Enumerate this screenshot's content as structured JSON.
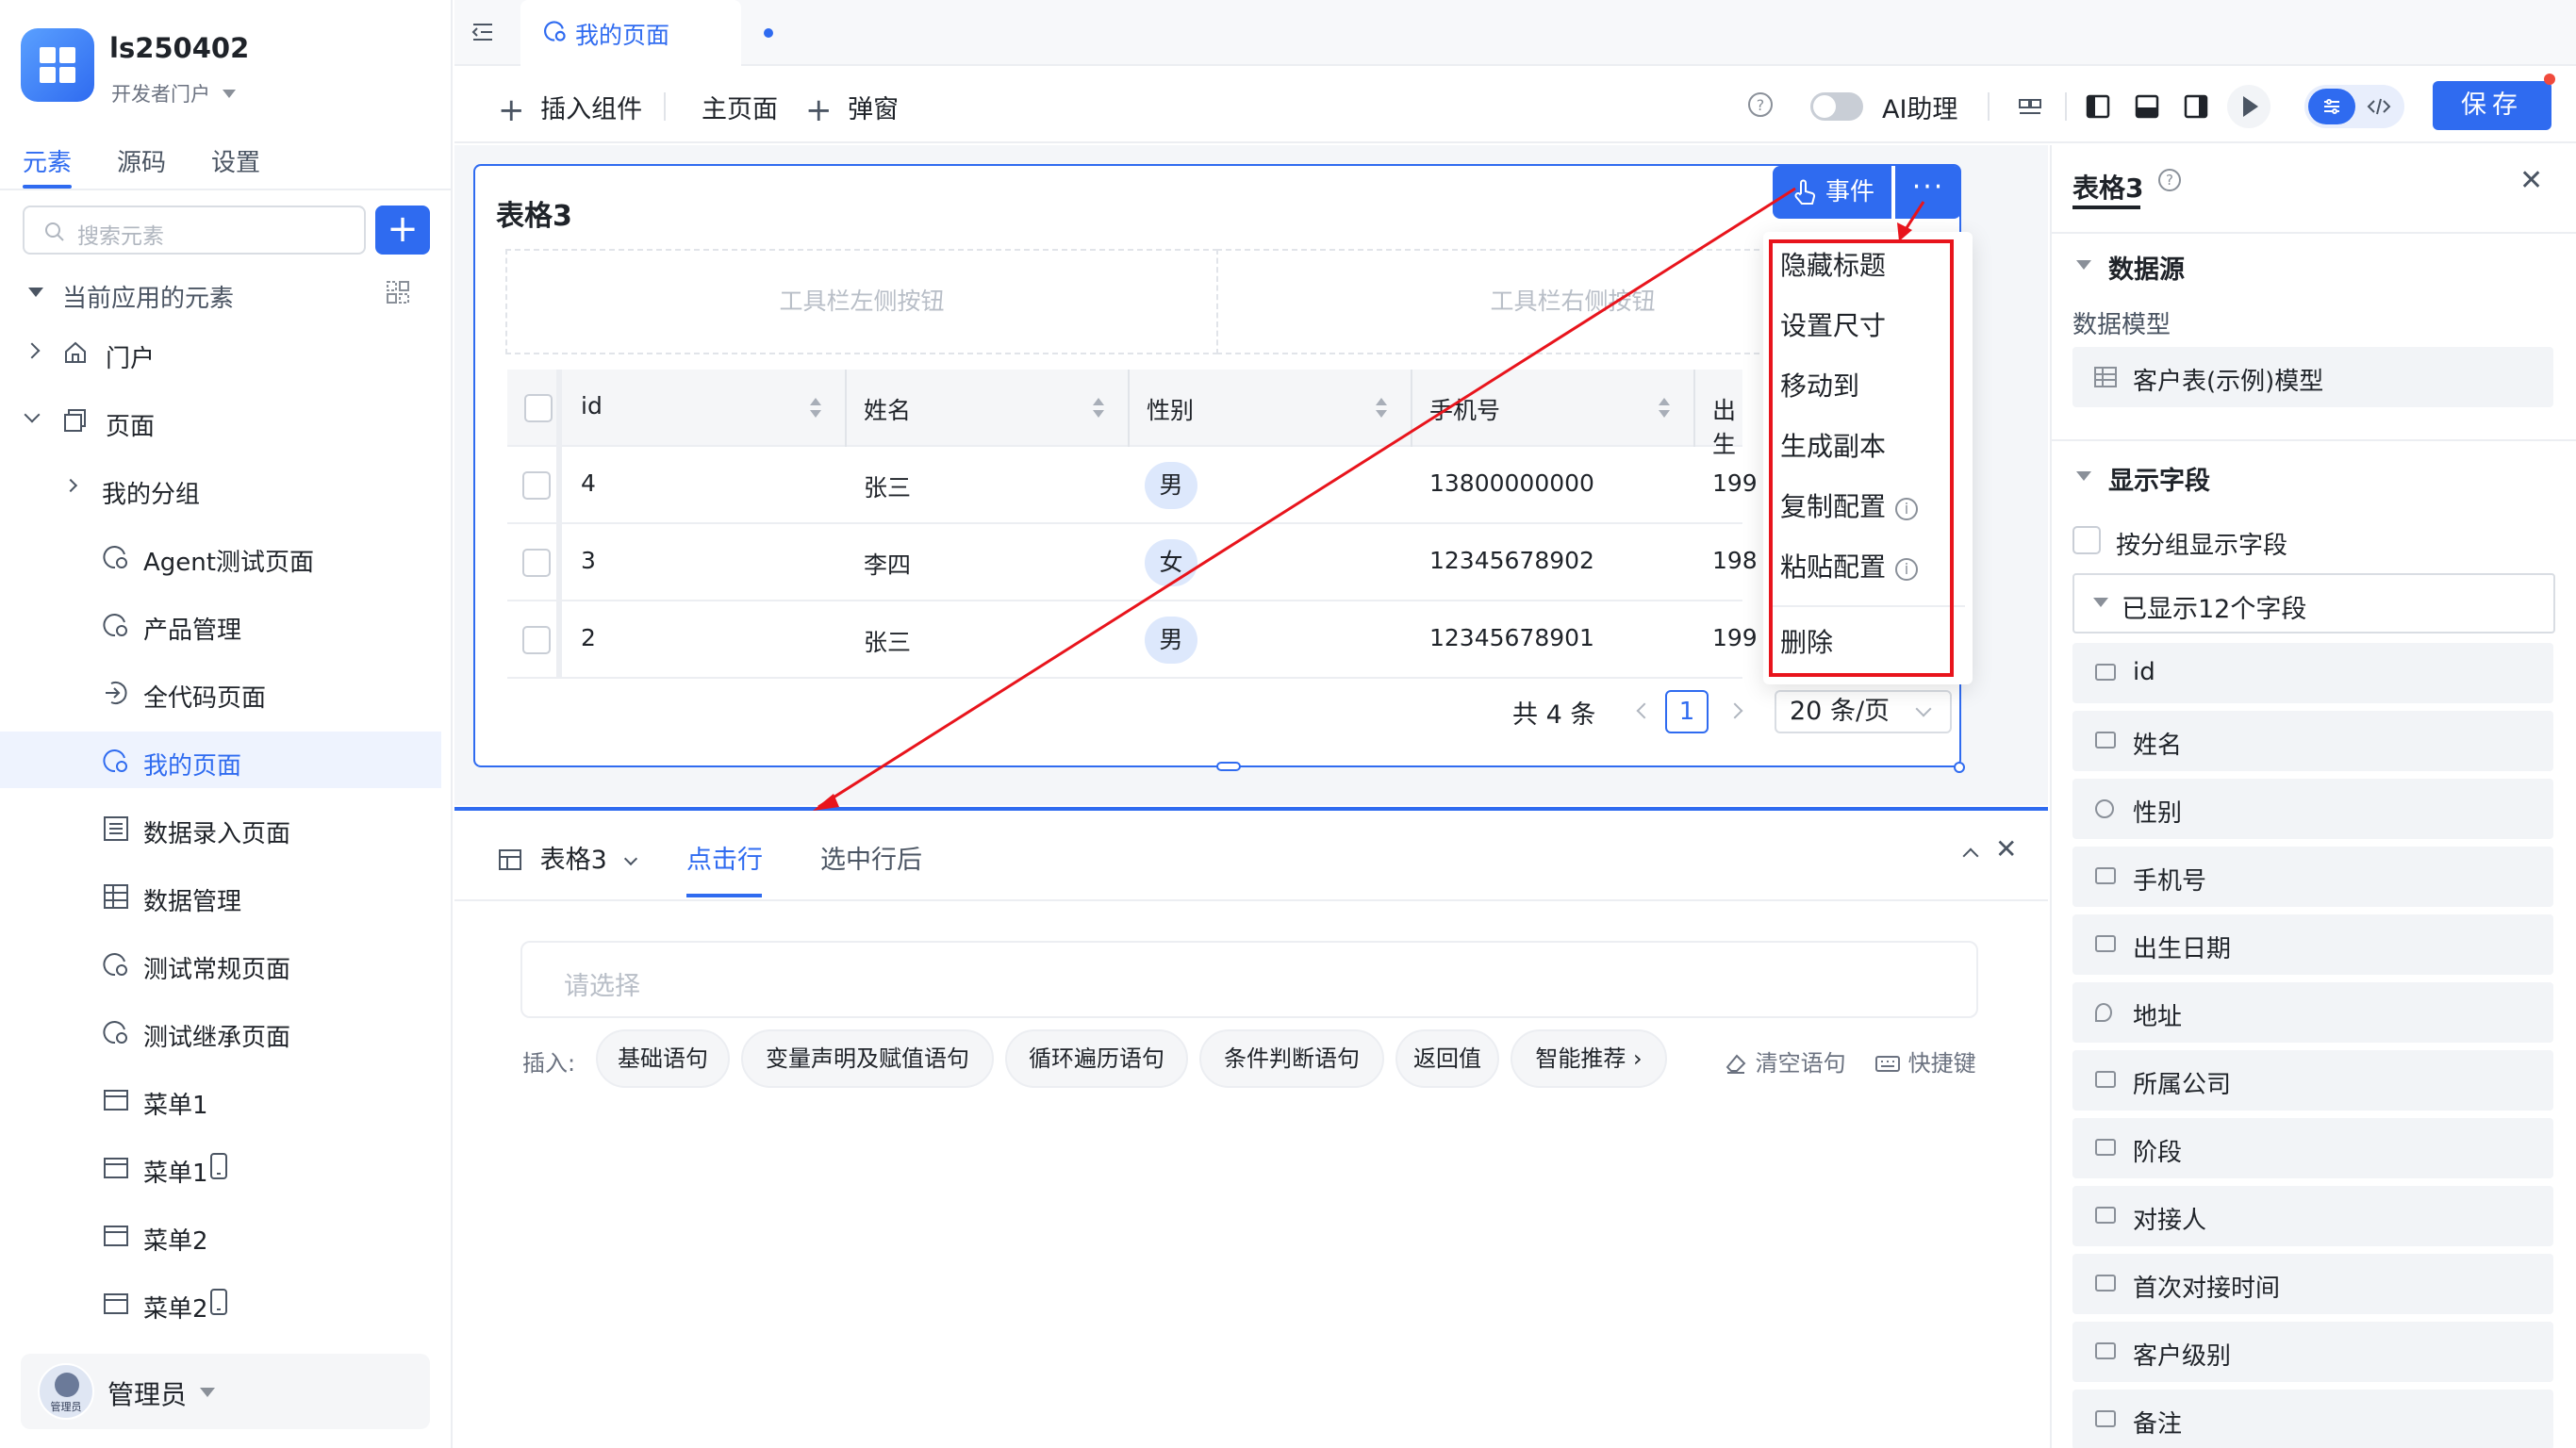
{
  "app": {
    "name": "ls250402",
    "subtitle": "开发者门户"
  },
  "sidebar": {
    "tabs": [
      "元素",
      "源码",
      "设置"
    ],
    "search_placeholder": "搜索元素",
    "add_label": "+",
    "section_label": "当前应用的元素",
    "tree": [
      {
        "label": "门户",
        "icon": "home-icon",
        "level": 1
      },
      {
        "label": "页面",
        "icon": "pages-icon",
        "level": 1
      },
      {
        "label": "我的分组",
        "icon": "",
        "level": 2
      },
      {
        "label": "Agent测试页面",
        "icon": "page-gear-icon",
        "level": 3
      },
      {
        "label": "产品管理",
        "icon": "page-gear-icon",
        "level": 3
      },
      {
        "label": "全代码页面",
        "icon": "code-page-icon",
        "level": 3
      },
      {
        "label": "我的页面",
        "icon": "page-gear-icon",
        "level": 3,
        "selected": true
      },
      {
        "label": "数据录入页面",
        "icon": "form-icon",
        "level": 3
      },
      {
        "label": "数据管理",
        "icon": "table-icon",
        "level": 3
      },
      {
        "label": "测试常规页面",
        "icon": "page-gear-icon",
        "level": 3
      },
      {
        "label": "测试继承页面",
        "icon": "page-gear-icon",
        "level": 3
      },
      {
        "label": "菜单1",
        "icon": "menu-icon",
        "level": 3
      },
      {
        "label": "菜单1",
        "icon": "menu-icon",
        "level": 3,
        "mobile": true
      },
      {
        "label": "菜单2",
        "icon": "menu-icon",
        "level": 3
      },
      {
        "label": "菜单2",
        "icon": "menu-icon",
        "level": 3,
        "mobile": true
      }
    ],
    "user": {
      "name": "管理员",
      "avatar_caption": "管理员"
    }
  },
  "header": {
    "tab_label": "我的页面",
    "toolbar": {
      "insert_component": "插入组件",
      "main_page": "主页面",
      "popup": "弹窗",
      "ai_assistant": "AI助理",
      "save": "保存"
    }
  },
  "canvas": {
    "table_title": "表格3",
    "toolbar_left": "工具栏左侧按钮",
    "toolbar_right": "工具栏右侧按钮",
    "event_button": "事件",
    "more_button": "···",
    "columns": [
      "id",
      "姓名",
      "性别",
      "手机号",
      "出生"
    ],
    "rows": [
      {
        "id": "4",
        "name": "张三",
        "sex": "男",
        "phone": "13800000000",
        "birth": "199"
      },
      {
        "id": "3",
        "name": "李四",
        "sex": "女",
        "phone": "12345678902",
        "birth": "198"
      },
      {
        "id": "2",
        "name": "张三",
        "sex": "男",
        "phone": "12345678901",
        "birth": "199"
      }
    ],
    "pager": {
      "total": "共 4 条",
      "page": "1",
      "page_size": "20 条/页"
    }
  },
  "context_menu": {
    "items": [
      {
        "label": "隐藏标题"
      },
      {
        "label": "设置尺寸"
      },
      {
        "label": "移动到"
      },
      {
        "label": "生成副本"
      },
      {
        "label": "复制配置",
        "info": true
      },
      {
        "label": "粘贴配置",
        "info": true
      },
      {
        "label": "删除"
      }
    ],
    "highlight_color": "#e8141c"
  },
  "editor": {
    "component": "表格3",
    "tabs": [
      "点击行",
      "选中行后"
    ],
    "active_tab": "点击行",
    "placeholder": "请选择",
    "insert_label": "插入:",
    "chips": [
      "基础语句",
      "变量声明及赋值语句",
      "循环遍历语句",
      "条件判断语句",
      "返回值",
      "智能推荐 ›"
    ],
    "clear": "清空语句",
    "shortcut": "快捷键"
  },
  "right_panel": {
    "title": "表格3",
    "datasource_header": "数据源",
    "data_model_label": "数据模型",
    "data_model_value": "客户表(示例)模型",
    "fields_header": "显示字段",
    "group_checkbox_label": "按分组显示字段",
    "shown_fields_summary": "已显示12个字段",
    "fields": [
      "id",
      "姓名",
      "性别",
      "手机号",
      "出生日期",
      "地址",
      "所属公司",
      "阶段",
      "对接人",
      "首次对接时间",
      "客户级别",
      "备注"
    ]
  },
  "colors": {
    "accent": "#2f6bf0",
    "annotation_red": "#e8141c"
  }
}
